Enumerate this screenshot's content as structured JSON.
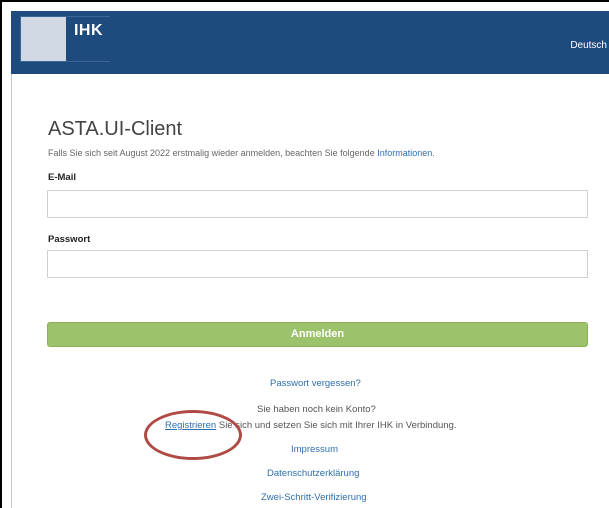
{
  "header": {
    "logo_text": "IHK",
    "language": "Deutsch"
  },
  "page": {
    "title": "ASTA.UI-Client",
    "hint_text": "Falls Sie sich seit August 2022 erstmalig wieder anmelden, beachten Sie folgende ",
    "hint_link": "Informationen",
    "hint_end": "."
  },
  "form": {
    "email_label": "E-Mail",
    "email_value": "",
    "password_label": "Passwort",
    "password_value": "",
    "submit_label": "Anmelden"
  },
  "links": {
    "forgot_password": "Passwort vergessen?",
    "no_account": "Sie haben noch kein Konto?",
    "register": "Registrieren",
    "register_rest": " Sie sich und setzen Sie sich mit Ihrer IHK in Verbindung.",
    "impressum": "Impressum",
    "privacy": "Datenschutzerklärung",
    "two_factor": "Zwei-Schritt-Verifizierung"
  },
  "colors": {
    "header_bg": "#1d4b7e",
    "button_bg": "#9dc26c",
    "link": "#2e6fae",
    "annotation_circle": "#b04a45"
  }
}
